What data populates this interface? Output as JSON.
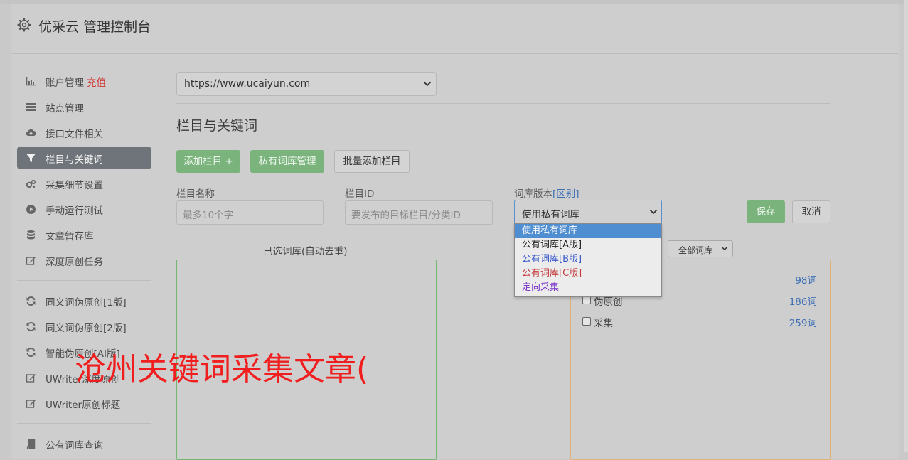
{
  "header": {
    "title": "优采云 管理控制台"
  },
  "sidebar": {
    "items": [
      {
        "label": "账户管理",
        "badge": "充值",
        "icon": "bar-chart-icon"
      },
      {
        "label": "站点管理",
        "icon": "server-icon"
      },
      {
        "label": "接口文件相关",
        "icon": "cloud-upload-icon"
      },
      {
        "label": "栏目与关键词",
        "icon": "filter-icon",
        "active": true
      },
      {
        "label": "采集细节设置",
        "icon": "gears-icon"
      },
      {
        "label": "手动运行测试",
        "icon": "play-circle-icon"
      },
      {
        "label": "文章暂存库",
        "icon": "database-icon"
      },
      {
        "label": "深度原创任务",
        "icon": "edit-icon"
      },
      {
        "label": "同义词伪原创[1版]",
        "icon": "refresh-icon"
      },
      {
        "label": "同义词伪原创[2版]",
        "icon": "refresh-icon"
      },
      {
        "label": "智能伪原创[AI版]",
        "icon": "refresh-icon"
      },
      {
        "label": "UWriter深度原创",
        "icon": "edit-icon"
      },
      {
        "label": "UWriter原创标题",
        "icon": "edit-icon"
      },
      {
        "label": "公有词库查询",
        "icon": "book-icon"
      }
    ]
  },
  "site_select": {
    "value": "https://www.ucaiyun.com"
  },
  "section": {
    "title": "栏目与关键词"
  },
  "toolbar": {
    "add_column": "添加栏目 +",
    "private_lib": "私有词库管理",
    "batch_add": "批量添加栏目"
  },
  "form": {
    "name_label": "栏目名称",
    "name_placeholder": "最多10个字",
    "id_label": "栏目ID",
    "id_placeholder": "要发布的目标栏目/分类ID",
    "version_label": "词库版本",
    "version_link": "[区别]",
    "version_value": "使用私有词库",
    "save": "保存",
    "cancel": "取消"
  },
  "dropdown": {
    "options": [
      "使用私有词库",
      "公有词库[A版]",
      "公有词库[B版]",
      "公有词库[C版]",
      "定向采集"
    ]
  },
  "chosen": {
    "title": "已选词库(自动去重)"
  },
  "library": {
    "filter_value": "全部词库",
    "rows": [
      {
        "name": "",
        "count": "98词"
      },
      {
        "name": "伪原创",
        "count": "186词"
      },
      {
        "name": "采集",
        "count": "259词"
      }
    ]
  },
  "overlay": {
    "text": "沧州关键词采集文章("
  },
  "colors": {
    "accent_green": "#7ab47c",
    "active_nav": "#6f747a",
    "overlay_red": "#f01e1e",
    "link_blue": "#3e6fb5"
  }
}
